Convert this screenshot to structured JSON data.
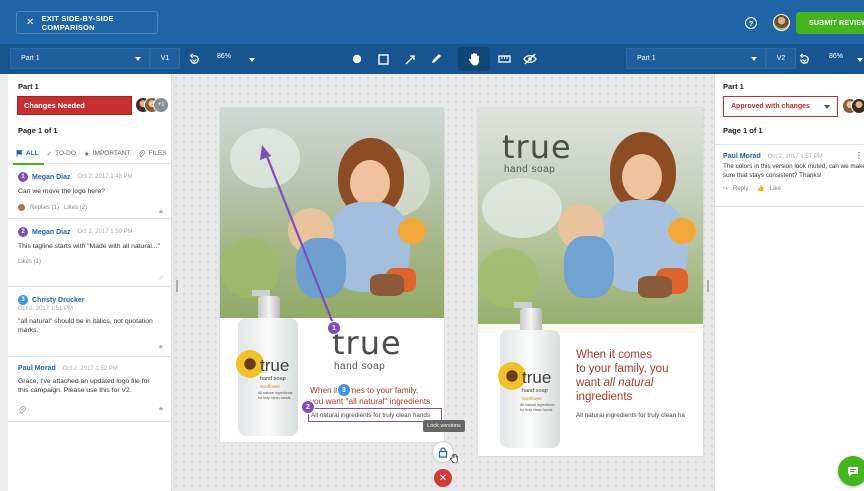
{
  "header": {
    "exit_label": "EXIT SIDE-BY-SIDE COMPARISON",
    "help_label": "?",
    "submit_label": "SUBMIT REVIEW"
  },
  "toolbar": {
    "left_part": "Part 1",
    "left_version": "V1",
    "left_zoom": "86%",
    "right_part": "Part 1",
    "right_version": "V2",
    "right_zoom": "86%"
  },
  "left_panel": {
    "part_title": "Part 1",
    "status": "Changes Needed",
    "extra_reviewers": "+1",
    "page_label": "Page 1 of 1",
    "tabs": [
      {
        "label": "ALL"
      },
      {
        "label": "TO-DO"
      },
      {
        "label": "IMPORTANT"
      },
      {
        "label": "FILES"
      }
    ],
    "comments": [
      {
        "number": "1",
        "author": "Megan Diaz",
        "time": "Oct 2, 2017 1:48 PM",
        "text": "Can we move the logo here?",
        "replies": "Replies (1)",
        "likes": "Likes (2)"
      },
      {
        "number": "2",
        "author": "Megan Diaz",
        "time": "Oct 2, 2017 1:50 PM",
        "text": "This tagline starts with \"Made with all natural...\"",
        "likes": "Likes (1)"
      },
      {
        "number": "3",
        "author": "Christy Drucker",
        "time": "Oct 2, 2017 1:51 PM",
        "text": "\"all natural\" should be in italics, not quotation marks."
      },
      {
        "author": "Paul Morad",
        "time": "Oct 2, 2017 1:52 PM",
        "text": "Grace, I've attached an updated logo file for this campaign. Please use this for V2."
      }
    ]
  },
  "canvas": {
    "left_art": {
      "brand": "true",
      "subbrand": "hand soap",
      "tagline_line1": "When it comes to your family,",
      "tagline_line2": "you want \"all natural\" ingredients",
      "footer": "All natural ingredients for truly clean hands",
      "bottle_brand": "true",
      "bottle_sub": "hand soap",
      "bottle_flavor": "Sunflower",
      "bottle_desc": "All natural ingredients for truly clean hands"
    },
    "right_art": {
      "brand": "true",
      "subbrand": "hand soap",
      "tagline_line1": "When it comes",
      "tagline_line2": "to your family, you",
      "tagline_line3_pre": "want ",
      "tagline_line3_em": "all natural",
      "tagline_line4": "ingredients",
      "footer": "All natural ingredients for truly clean ha",
      "bottle_brand": "true",
      "bottle_sub": "hand soap",
      "bottle_flavor": "Sunflower",
      "bottle_desc": "All natural ingredients for truly clean hands"
    },
    "marker_1": "1",
    "marker_2": "2",
    "marker_3": "3",
    "lock_tooltip": "Lock versions"
  },
  "right_panel": {
    "part_title": "Part 1",
    "status": "Approved with changes",
    "page_label": "Page 1 of 1",
    "comment": {
      "author": "Paul Morad",
      "time": "Oct 2, 2017 1:57 PM",
      "text": "The colors in this version look muted, can we make sure that stays consistent? Thanks!",
      "reply": "Reply",
      "like": "Like"
    }
  },
  "colors": {
    "header_blue": "#1e64a6",
    "toolbar_blue": "#16558f",
    "accent_green": "#45b51f",
    "status_red": "#c62f2f",
    "marker_purple": "#7b4fb8",
    "marker_blue": "#3c96e2"
  }
}
